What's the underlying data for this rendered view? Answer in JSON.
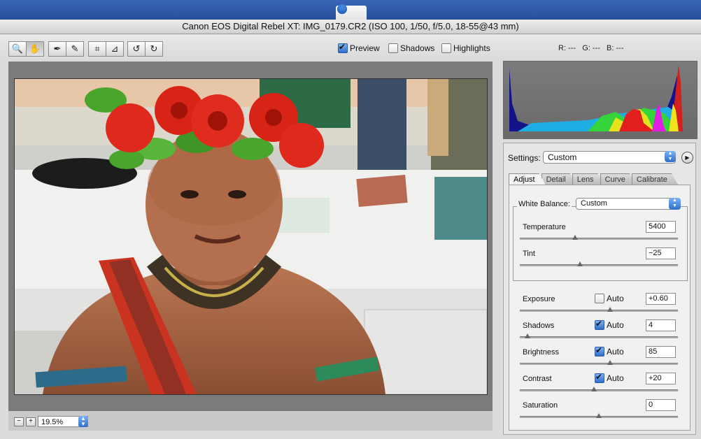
{
  "window": {
    "title": "Canon EOS Digital Rebel XT:  IMG_0179.CR2  (ISO 100, 1/50, f/5.0, 18-55@43 mm)"
  },
  "toolbar": {
    "tools": [
      "zoom-tool",
      "hand-tool",
      "white-balance-tool",
      "color-sampler-tool",
      "crop-tool",
      "straighten-tool",
      "rotate-left-tool",
      "rotate-right-tool"
    ],
    "preview_label": "Preview",
    "preview_checked": true,
    "shadows_label": "Shadows",
    "shadows_checked": false,
    "highlights_label": "Highlights",
    "highlights_checked": false,
    "readout": "R: ---   G: ---   B: ---"
  },
  "zoom": {
    "minus": "−",
    "plus": "+",
    "value": "19.5%"
  },
  "settings": {
    "label": "Settings:",
    "value": "Custom"
  },
  "tabs": [
    "Adjust",
    "Detail",
    "Lens",
    "Curve",
    "Calibrate"
  ],
  "white_balance": {
    "label": "White Balance:",
    "value": "Custom"
  },
  "sliders": [
    {
      "label": "Temperature",
      "value": "5400",
      "level": 0.35
    },
    {
      "label": "Tint",
      "value": "−25",
      "level": 0.38
    },
    {
      "label": "Exposure",
      "value": "+0.60",
      "level": 0.57,
      "auto": false
    },
    {
      "label": "Shadows",
      "value": "4",
      "level": 0.05,
      "auto": true
    },
    {
      "label": "Brightness",
      "value": "85",
      "level": 0.57,
      "auto": true
    },
    {
      "label": "Contrast",
      "value": "+20",
      "level": 0.47,
      "auto": true
    },
    {
      "label": "Saturation",
      "value": "0",
      "level": 0.5
    }
  ],
  "auto_label": "Auto",
  "colors": {
    "accent": "#2f6fc9",
    "desktop": "#3a66b8",
    "histogram_bg": "#111111"
  }
}
